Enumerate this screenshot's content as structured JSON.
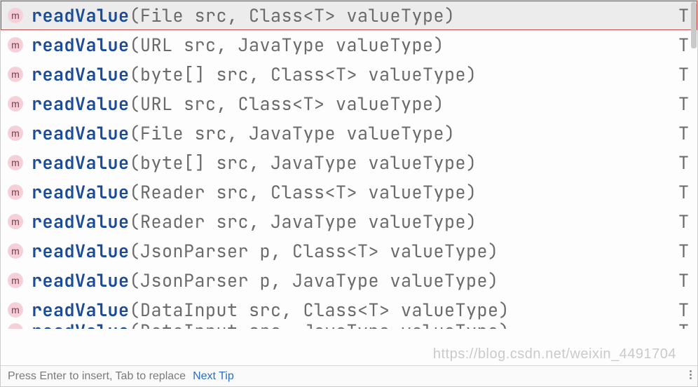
{
  "icon_letter": "m",
  "method_name": "readValue",
  "name_parts": {
    "pre": "re",
    "match": "ad",
    "post": "Value"
  },
  "items": [
    {
      "params": "(File src, Class<T> valueType)",
      "ret": "T",
      "selected": true
    },
    {
      "params": "(URL src, JavaType valueType)",
      "ret": "T",
      "selected": false
    },
    {
      "params": "(byte[] src, Class<T> valueType)",
      "ret": "T",
      "selected": false
    },
    {
      "params": "(URL src, Class<T> valueType)",
      "ret": "T",
      "selected": false
    },
    {
      "params": "(File src, JavaType valueType)",
      "ret": "T",
      "selected": false
    },
    {
      "params": "(byte[] src, JavaType valueType)",
      "ret": "T",
      "selected": false
    },
    {
      "params": "(Reader src, Class<T> valueType)",
      "ret": "T",
      "selected": false
    },
    {
      "params": "(Reader src, JavaType valueType)",
      "ret": "T",
      "selected": false
    },
    {
      "params": "(JsonParser p, Class<T> valueType)",
      "ret": "T",
      "selected": false
    },
    {
      "params": "(JsonParser p, JavaType valueType)",
      "ret": "T",
      "selected": false
    },
    {
      "params": "(DataInput src, Class<T> valueType)",
      "ret": "T",
      "selected": false
    }
  ],
  "partial_item": {
    "params": "(DataInput src, JavaType valueType)",
    "ret": "T"
  },
  "footer": {
    "hint": "Press Enter to insert, Tab to replace",
    "link": "Next Tip"
  },
  "watermark": "https://blog.csdn.net/weixin_4491704"
}
